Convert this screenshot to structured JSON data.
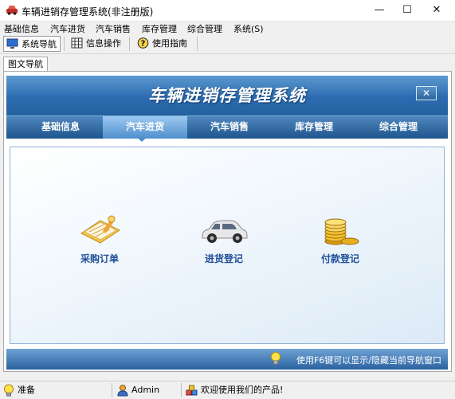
{
  "window": {
    "title": "车辆进销存管理系统(非注册版)",
    "minimize_glyph": "—",
    "maximize_glyph": "☐",
    "close_glyph": "✕"
  },
  "menubar": {
    "items": [
      "基础信息",
      "汽车进货",
      "汽车销售",
      "库存管理",
      "综合管理",
      "系统(S)"
    ]
  },
  "toolbar": {
    "buttons": [
      {
        "label": "系统导航",
        "icon": "monitor-icon"
      },
      {
        "label": "信息操作",
        "icon": "grid-icon"
      },
      {
        "label": "使用指南",
        "icon": "help-icon"
      }
    ]
  },
  "doc_tab": {
    "label": "图文导航"
  },
  "banner": {
    "title": "车辆进销存管理系统",
    "close_glyph": "✕"
  },
  "nav": {
    "tabs": [
      "基础信息",
      "汽车进货",
      "汽车销售",
      "库存管理",
      "综合管理"
    ],
    "active_index": 1
  },
  "functions": [
    {
      "label": "采购订单",
      "icon": "order-notepad-icon"
    },
    {
      "label": "进货登记",
      "icon": "car-icon"
    },
    {
      "label": "付款登记",
      "icon": "gold-coins-icon"
    }
  ],
  "hint": {
    "text": "使用F6键可以显示/隐藏当前导航窗口",
    "icon": "lightbulb-icon"
  },
  "statusbar": {
    "status": "准备",
    "user": "Admin",
    "welcome": "欢迎使用我们的产品!"
  },
  "colors": {
    "banner": "#2c6bb0",
    "nav_active": "#4f8fcc",
    "label_blue": "#1f4f9a"
  }
}
